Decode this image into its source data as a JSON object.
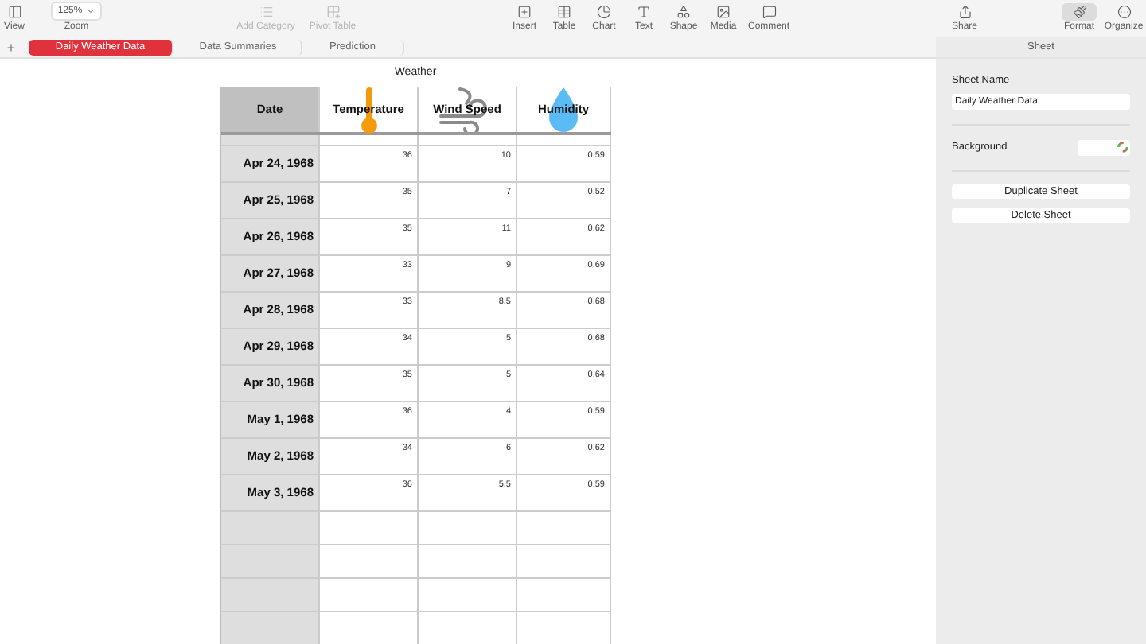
{
  "toolbar": {
    "left": [
      {
        "kind": "view",
        "label": "View"
      },
      {
        "label": "Zoom",
        "value": "125%"
      }
    ],
    "middle": [
      {
        "kind": "category",
        "label": "Add Category",
        "disabled": true
      },
      {
        "kind": "pivot",
        "label": "Pivot Table",
        "disabled": true
      }
    ],
    "insert": [
      {
        "kind": "insert",
        "label": "Insert",
        "disabled": false
      },
      {
        "kind": "table",
        "label": "Table",
        "disabled": false
      },
      {
        "kind": "chart",
        "label": "Chart",
        "disabled": false
      },
      {
        "kind": "text",
        "label": "Text",
        "disabled": false
      },
      {
        "kind": "shape",
        "label": "Shape",
        "disabled": false
      },
      {
        "kind": "media",
        "label": "Media",
        "disabled": false
      },
      {
        "kind": "comment",
        "label": "Comment",
        "disabled": false
      }
    ],
    "share": {
      "kind": "share",
      "label": "Share",
      "disabled": false
    },
    "right": [
      {
        "kind": "format",
        "label": "Format",
        "selected": true
      },
      {
        "kind": "organize",
        "label": "Organize",
        "selected": false
      }
    ]
  },
  "sheet_tabs": {
    "add": "+",
    "tabs": [
      {
        "label": "Daily Weather Data",
        "selected": true
      },
      {
        "label": "Data Summaries",
        "selected": false
      },
      {
        "label": "Prediction",
        "selected": false
      }
    ]
  },
  "table": {
    "title": "Weather",
    "columns": [
      {
        "label": "Date",
        "kind": "plain"
      },
      {
        "label": "Temperature",
        "kind": "thermometer"
      },
      {
        "label": "Wind Speed",
        "kind": "wind"
      },
      {
        "label": "Humidity",
        "kind": "drop"
      }
    ],
    "rows": [
      [
        "Apr 24, 1968",
        "36",
        "10",
        "0.59"
      ],
      [
        "Apr 25, 1968",
        "35",
        "7",
        "0.52"
      ],
      [
        "Apr 26, 1968",
        "35",
        "11",
        "0.62"
      ],
      [
        "Apr 27, 1968",
        "33",
        "9",
        "0.69"
      ],
      [
        "Apr 28, 1968",
        "33",
        "8.5",
        "0.68"
      ],
      [
        "Apr 29, 1968",
        "34",
        "5",
        "0.68"
      ],
      [
        "Apr 30, 1968",
        "35",
        "5",
        "0.64"
      ],
      [
        "May 1, 1968",
        "36",
        "4",
        "0.59"
      ],
      [
        "May 2, 1968",
        "34",
        "6",
        "0.62"
      ],
      [
        "May 3, 1968",
        "36",
        "5.5",
        "0.59"
      ]
    ]
  },
  "inspector": {
    "title": "Sheet",
    "sheet_name_label": "Sheet Name",
    "sheet_name": "Daily Weather Data",
    "background_label": "Background",
    "buttons": [
      "Duplicate Sheet",
      "Delete Sheet"
    ]
  }
}
